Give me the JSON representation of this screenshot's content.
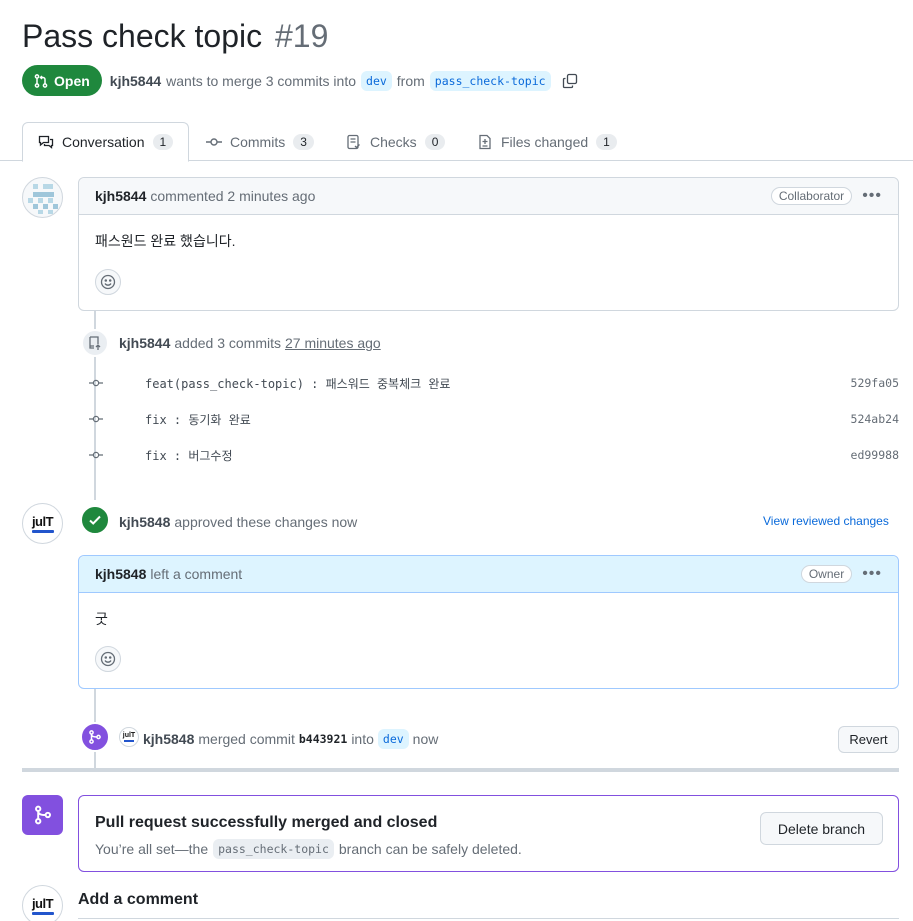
{
  "pr": {
    "title": "Pass check topic",
    "number": "#19",
    "state": "Open",
    "author": "kjh5844",
    "summary_pre": "wants to merge 3 commits into",
    "base_branch": "dev",
    "from_word": "from",
    "head_branch": "pass_check-topic"
  },
  "tabs": [
    {
      "label": "Conversation",
      "count": "1"
    },
    {
      "label": "Commits",
      "count": "3"
    },
    {
      "label": "Checks",
      "count": "0"
    },
    {
      "label": "Files changed",
      "count": "1"
    }
  ],
  "comment1": {
    "author": "kjh5844",
    "meta": "commented 2 minutes ago",
    "role": "Collaborator",
    "body": "패스원드 완료 했습니다."
  },
  "commits_event": {
    "author": "kjh5844",
    "text": "added 3 commits",
    "time": "27 minutes ago",
    "commits": [
      {
        "message": "feat(pass_check-topic) : 패스워드 중복체크 완료",
        "sha": "529fa05"
      },
      {
        "message": "fix : 동기화 완료",
        "sha": "524ab24"
      },
      {
        "message": "fix : 버그수정",
        "sha": "ed99988"
      }
    ]
  },
  "review": {
    "author": "kjh5848",
    "text": "approved these changes now",
    "link": "View reviewed changes"
  },
  "comment2": {
    "author": "kjh5848",
    "meta": "left a comment",
    "role": "Owner",
    "body": "굿"
  },
  "merge_event": {
    "author": "kjh5848",
    "text": "merged commit",
    "sha": "b443921",
    "into_word": "into",
    "branch": "dev",
    "time": "now",
    "revert_label": "Revert"
  },
  "merged_box": {
    "title": "Pull request successfully merged and closed",
    "sub_pre": "You’re all set—the",
    "branch": "pass_check-topic",
    "sub_post": "branch can be safely deleted.",
    "delete_label": "Delete branch"
  },
  "add_comment": {
    "title": "Add a comment"
  },
  "avatar_logo": {
    "text": "julT"
  },
  "colors": {
    "open_green": "#1f883d",
    "merged_purple": "#8250df",
    "link_blue": "#0969da"
  }
}
